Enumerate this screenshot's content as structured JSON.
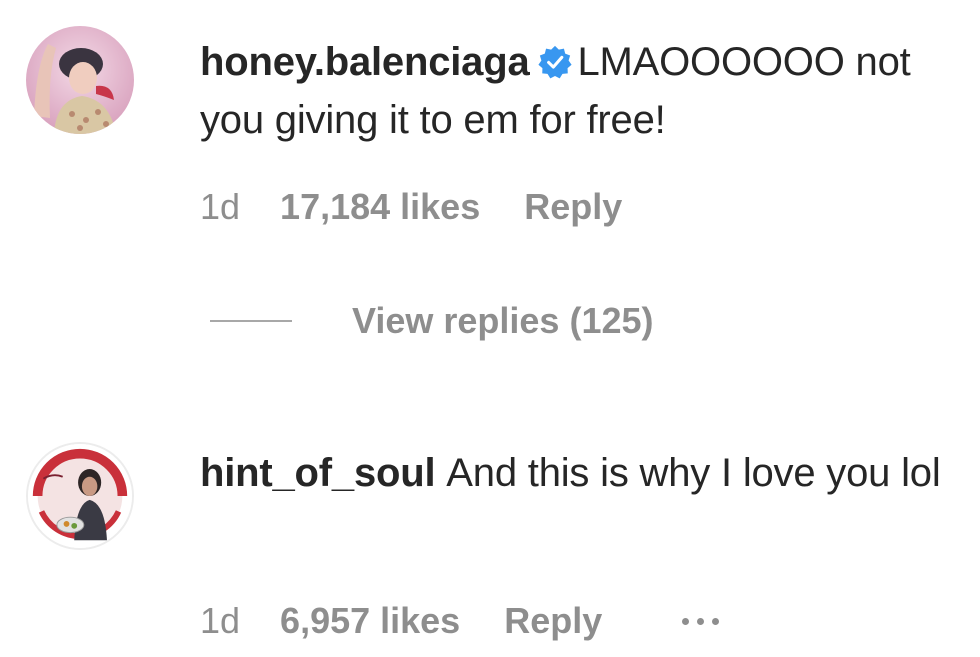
{
  "comments": [
    {
      "username": "honey.balenciaga",
      "verified": true,
      "text": "LMAOOOOOO not you giving it to em for free!",
      "time": "1d",
      "likes": "17,184 likes",
      "reply_label": "Reply",
      "view_replies": "View replies (125)"
    },
    {
      "username": "hint_of_soul",
      "verified": false,
      "text": "And this is why I love you lol",
      "time": "1d",
      "likes": "6,957 likes",
      "reply_label": "Reply",
      "more_icon": "more-horizontal-icon"
    }
  ],
  "colors": {
    "text_primary": "#262626",
    "text_secondary": "#8e8e8e",
    "verified_blue": "#3897f0"
  }
}
